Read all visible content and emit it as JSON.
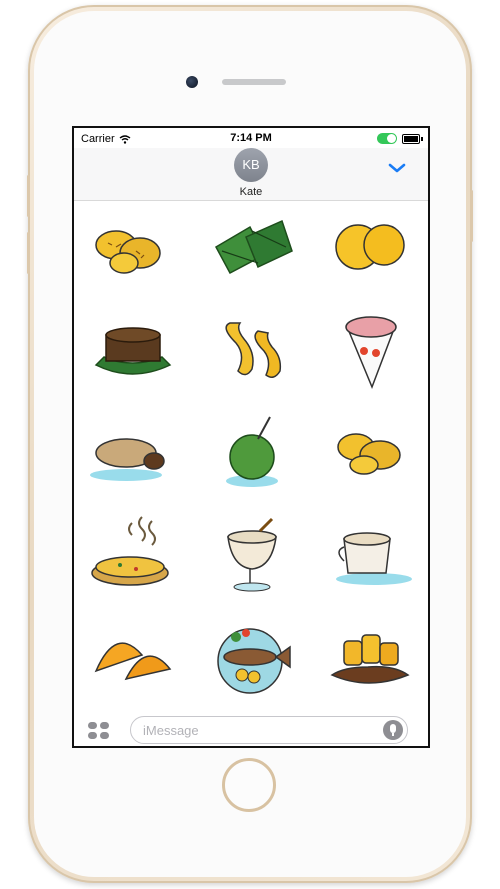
{
  "status_bar": {
    "carrier": "Carrier",
    "time": "7:14 PM"
  },
  "conversation": {
    "avatar_initials": "KB",
    "contact_name": "Kate"
  },
  "stickers": [
    "fried-plantains",
    "banana-leaf-wraps",
    "yellow-buns",
    "leaf-cake",
    "yellow-pastries",
    "shaved-ice-cone",
    "stuffed-plantain",
    "coconut-drink",
    "fried-plantains-2",
    "steaming-rice-pie",
    "cinnamon-drink",
    "hot-cup",
    "empanadas",
    "fish-plate",
    "plantains-in-sauce"
  ],
  "input": {
    "placeholder": "iMessage"
  },
  "colors": {
    "accent": "#1a7cf5",
    "yellow": "#f2c12e",
    "green": "#2f8a3a",
    "brown": "#6b3d1f"
  }
}
